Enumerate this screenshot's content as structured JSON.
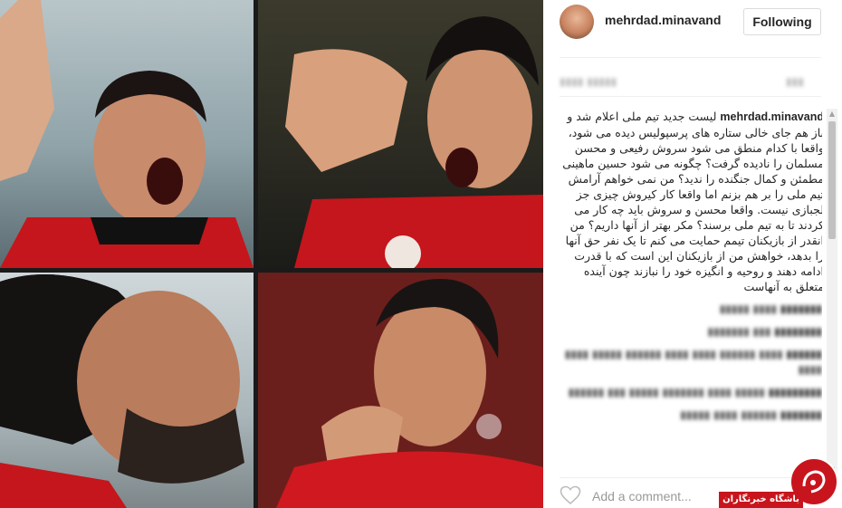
{
  "post": {
    "username": "mehrdad.minavand",
    "follow_label": "Following",
    "caption_user": "mehrdad.minavand",
    "caption_text": "لیست جدید تیم ملی اعلام شد و باز هم جای خالی ستاره های پرسپولیس دیده می شود، واقعا با کدام منطق می شود سروش رفیعی و محسن مسلمان را نادیده گرفت؟ چگونه می شود حسین ماهینی مطمئن و کمال جنگنده را ندید؟ من نمی خواهم آرامش تیم ملی را بر هم بزنم اما واقعا کار کیروش چیزی جز لجبازی نیست. واقعا محسن و سروش باید چه کار می کردند تا به تیم ملی برسند؟ مکر بهتر از آنها داریم؟ من انقدر از بازیکنان تیمم حمایت می کنم تا یک نفر حق آنها را بدهد، خواهش من از بازیکنان این است که با قدرت ادامه دهند و روحیه و انگیزه خود را نبازند چون آینده متعلق به آنهاست",
    "add_comment_placeholder": "Add a comment..."
  },
  "watermark": {
    "text": "باشگاه خبرنگاران"
  },
  "icons": {
    "heart": "heart-outline-icon",
    "scroll_up": "scroll-up-arrow-icon",
    "scroll_down": "scroll-down-arrow-icon"
  },
  "colors": {
    "username": "#262626",
    "placeholder": "#999999",
    "border": "#dbdbdb",
    "watermark_red": "#c8151d"
  }
}
